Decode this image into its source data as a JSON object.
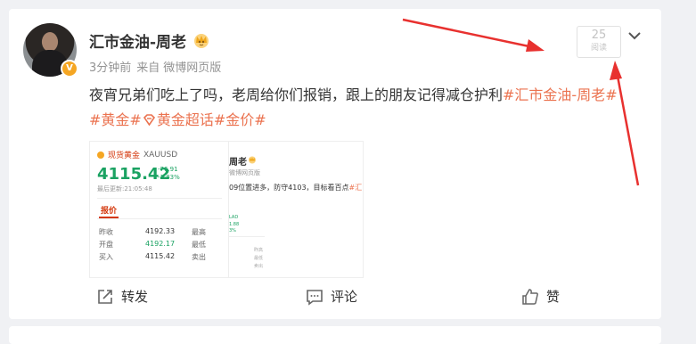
{
  "post": {
    "author": "汇市金油-周老",
    "verified_badge": "V",
    "time": "3分钟前",
    "source_prefix": "来自",
    "source": "微博网页版",
    "read_count": "25",
    "read_label": "阅读",
    "text_main": "夜宵兄弟们吃上了吗，老周给你们报销，跟上的朋友记得减仓护利",
    "tag_author": "#汇市金油-周老#",
    "tag_gold": "#黄金#",
    "tag_super": "黄金超话",
    "tag_price": "#金价#"
  },
  "quote_card": {
    "label": "现货黄金",
    "symbol": "XAUUSD",
    "price": "4115.42",
    "change": "-76.91",
    "change_pct": "-1.83%",
    "updated": "最后更新:21:05:48",
    "tab": "报价",
    "rows": [
      {
        "k": "昨收",
        "v": "4192.33",
        "k2": "最高"
      },
      {
        "k": "开盘",
        "v": "4192.17",
        "k2": "最低"
      },
      {
        "k": "买入",
        "v": "4115.42",
        "k2": "卖出"
      }
    ]
  },
  "repost_card": {
    "name_fragment": "周老",
    "source_fragment": "微博网页版",
    "text_fragment": "09位置进多，防守4103，目标看百点",
    "tag_fragment": "#汇",
    "mini_lines": [
      "LAD",
      "1.88",
      "3%",
      "昨高",
      "最低",
      "卖出"
    ]
  },
  "actions": {
    "repost": "转发",
    "comment": "评论",
    "like": "赞"
  },
  "colors": {
    "accent": "#eb7350",
    "arrow": "#e8312f",
    "green": "#1aa262"
  }
}
